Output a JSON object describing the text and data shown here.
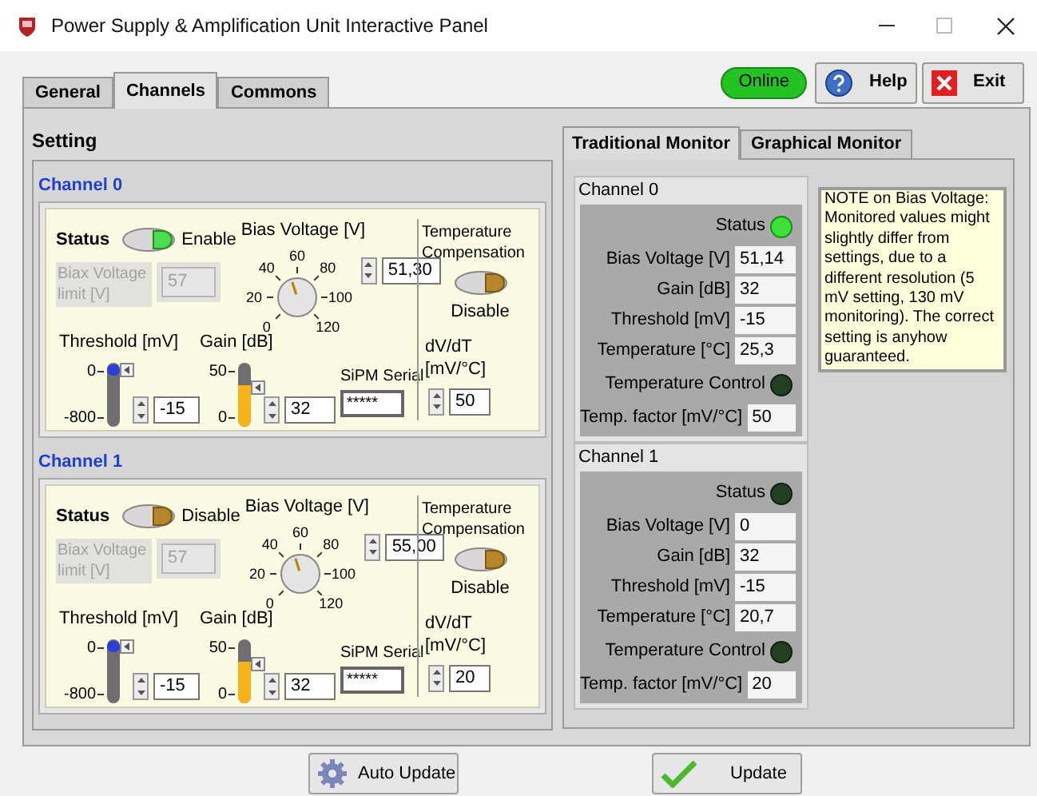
{
  "window": {
    "title": "Power Supply & Amplification Unit Interactive Panel"
  },
  "tabs": [
    {
      "label": "General",
      "selected": false
    },
    {
      "label": "Channels",
      "selected": true
    },
    {
      "label": "Commons",
      "selected": false
    }
  ],
  "connection": {
    "label": "Online",
    "on": true
  },
  "header_buttons": [
    {
      "kind": "help",
      "label": "Help"
    },
    {
      "kind": "exit",
      "label": "Exit"
    }
  ],
  "setting": {
    "heading": "Setting",
    "channels": [
      {
        "title": "Channel 0",
        "status": {
          "label": "Status",
          "on": true,
          "state_text": "Enable"
        },
        "bias_limit": {
          "label": "Biax Voltage limit [V]",
          "value": "57",
          "disabled": true
        },
        "bias_voltage": {
          "label": "Bias Voltage [V]",
          "ticks": [
            "0",
            "20",
            "40",
            "60",
            "80",
            "100",
            "120"
          ],
          "value": "51,30"
        },
        "sliders": [
          {
            "kind": "pointer",
            "label": "Threshold [mV]",
            "max": "0",
            "min": "-800",
            "level": 0.98,
            "value": "-15"
          },
          {
            "kind": "fill",
            "label": "Gain [dB]",
            "max": "50",
            "min": "0",
            "level": 0.64,
            "value": "32"
          }
        ],
        "serial": {
          "label": "SiPM Serial",
          "value": "*****"
        },
        "temp_compensation": {
          "label": "Temperature Compensation",
          "on": false,
          "state_text": "Disable"
        },
        "dv_dt": {
          "label": "dV/dT [mV/°C]",
          "value": "50"
        }
      },
      {
        "title": "Channel 1",
        "status": {
          "label": "Status",
          "on": false,
          "state_text": "Disable"
        },
        "bias_limit": {
          "label": "Biax Voltage limit [V]",
          "value": "57",
          "disabled": true
        },
        "bias_voltage": {
          "label": "Bias Voltage [V]",
          "ticks": [
            "0",
            "20",
            "40",
            "60",
            "80",
            "100",
            "120"
          ],
          "value": "55,00"
        },
        "sliders": [
          {
            "kind": "pointer",
            "label": "Threshold [mV]",
            "max": "0",
            "min": "-800",
            "level": 0.98,
            "value": "-15"
          },
          {
            "kind": "fill",
            "label": "Gain [dB]",
            "max": "50",
            "min": "0",
            "level": 0.64,
            "value": "32"
          }
        ],
        "serial": {
          "label": "SiPM Serial",
          "value": "*****"
        },
        "temp_compensation": {
          "label": "Temperature Compensation",
          "on": false,
          "state_text": "Disable"
        },
        "dv_dt": {
          "label": "dV/dT [mV/°C]",
          "value": "20"
        }
      }
    ]
  },
  "monitor": {
    "tabs": [
      {
        "label": "Traditional Monitor",
        "selected": true
      },
      {
        "label": "Graphical Monitor",
        "selected": false
      }
    ],
    "channels": [
      {
        "title": "Channel 0",
        "items": [
          {
            "kind": "led",
            "label": "Status",
            "on": true
          },
          {
            "kind": "field",
            "label": "Bias Voltage [V]",
            "value": "51,14"
          },
          {
            "kind": "field",
            "label": "Gain [dB]",
            "value": "32"
          },
          {
            "kind": "field",
            "label": "Threshold [mV]",
            "value": "-15"
          },
          {
            "kind": "field",
            "label": "Temperature [°C]",
            "value": "25,3"
          },
          {
            "kind": "led",
            "label": "Temperature Control",
            "on": false
          },
          {
            "kind": "field",
            "label": "Temp. factor [mV/°C]",
            "value": "50"
          }
        ]
      },
      {
        "title": "Channel 1",
        "items": [
          {
            "kind": "led",
            "label": "Status",
            "on": false
          },
          {
            "kind": "field",
            "label": "Bias Voltage [V]",
            "value": "0"
          },
          {
            "kind": "field",
            "label": "Gain [dB]",
            "value": "32"
          },
          {
            "kind": "field",
            "label": "Threshold [mV]",
            "value": "-15"
          },
          {
            "kind": "field",
            "label": "Temperature [°C]",
            "value": "20,7"
          },
          {
            "kind": "led",
            "label": "Temperature Control",
            "on": false
          },
          {
            "kind": "field",
            "label": "Temp. factor [mV/°C]",
            "value": "20"
          }
        ]
      }
    ],
    "note": "NOTE on Bias Voltage: Monitored values might slightly differ from settings, due to a different resolution (5 mV setting, 130 mV monitoring). The correct setting is anyhow guaranteed."
  },
  "footer_buttons": [
    {
      "kind": "auto",
      "label": "Auto Update"
    },
    {
      "kind": "update",
      "label": "Update"
    }
  ]
}
